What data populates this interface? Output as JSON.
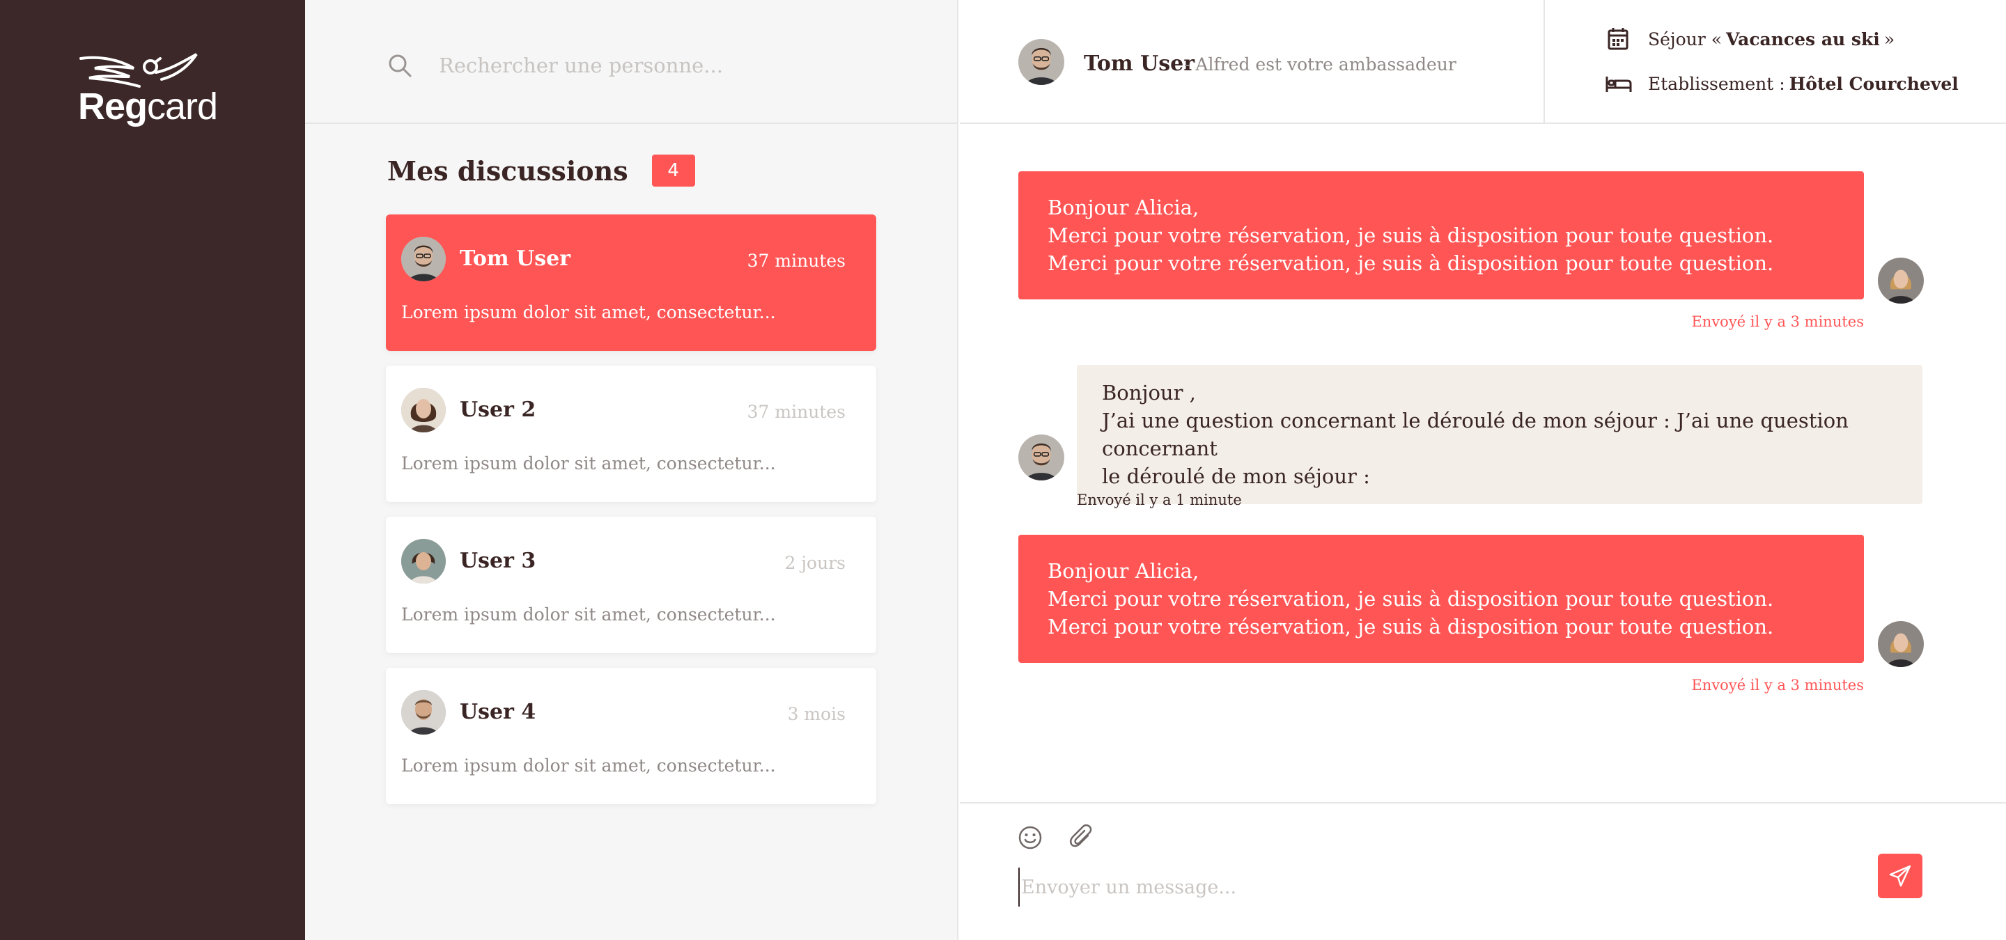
{
  "brand": {
    "logo_reg": "Reg",
    "logo_card": "card",
    "logo_icon": "bird-logo-icon"
  },
  "colors": {
    "accent": "#ff5555",
    "sidebar_bg": "#3c2828",
    "incoming_bubble": "#f3eee8",
    "text_dark": "#3a2524"
  },
  "search": {
    "placeholder": "Rechercher une personne..."
  },
  "discussions": {
    "title": "Mes discussions",
    "count": "4",
    "items": [
      {
        "name": "Tom User",
        "time": "37 minutes",
        "preview": "Lorem ipsum dolor sit amet, consectetur...",
        "active": true
      },
      {
        "name": "User 2",
        "time": "37 minutes",
        "preview": "Lorem ipsum dolor sit amet, consectetur...",
        "active": false
      },
      {
        "name": "User 3",
        "time": "2 jours",
        "preview": "Lorem ipsum dolor sit amet, consectetur...",
        "active": false
      },
      {
        "name": "User 4",
        "time": "3 mois",
        "preview": "Lorem ipsum dolor sit amet, consectetur...",
        "active": false
      }
    ]
  },
  "header": {
    "name": "Tom User",
    "subtitle": "- Alfred est votre ambassadeur",
    "stay_prefix": "Séjour «",
    "stay_value": "Vacances au ski",
    "stay_suffix": "»",
    "estab_prefix": "Etablissement :",
    "estab_value": "Hôtel Courchevel"
  },
  "messages": [
    {
      "direction": "out",
      "lines": [
        "Bonjour Alicia,",
        "Merci pour votre réservation, je suis à disposition pour toute question.",
        "Merci pour votre réservation, je suis à disposition pour toute question."
      ],
      "meta": "Envoyé il y a 3 minutes"
    },
    {
      "direction": "in",
      "lines": [
        "Bonjour ,",
        "J’ai une question concernant le déroulé de mon séjour : J’ai une question concernant",
        "le déroulé de mon séjour :"
      ],
      "meta": "Envoyé il y a 1 minute"
    },
    {
      "direction": "out",
      "lines": [
        "Bonjour Alicia,",
        "Merci pour votre réservation, je suis à disposition pour toute question.",
        "Merci pour votre réservation, je suis à disposition pour toute question."
      ],
      "meta": "Envoyé il y a 3 minutes"
    }
  ],
  "composer": {
    "placeholder": "Envoyer un message..."
  }
}
